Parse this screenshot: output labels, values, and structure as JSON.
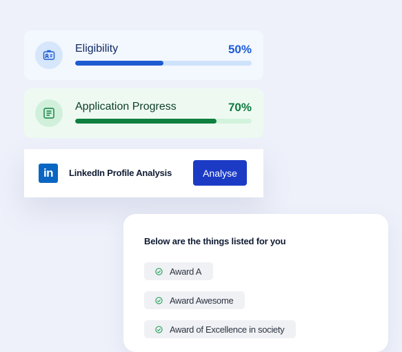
{
  "eligibility": {
    "title": "Eligibility",
    "percent_text": "50%",
    "progress": 0.5
  },
  "application": {
    "title": "Application Progress",
    "percent_text": "70%",
    "progress": 0.8
  },
  "linkedin": {
    "logo": "in",
    "label": "LinkedIn Profile Analysis",
    "button": "Analyse"
  },
  "list": {
    "heading": "Below are the things listed for you",
    "items": [
      "Award A",
      "Award Awesome",
      "Award of Excellence in society"
    ]
  },
  "colors": {
    "primary_blue": "#1d5bd1",
    "success_green": "#0f7f40",
    "button_blue": "#1c3bc5",
    "linkedin_blue": "#0a66c2"
  },
  "icons": [
    "id-card-icon",
    "document-list-icon",
    "linkedin-icon",
    "check-circle-icon"
  ]
}
